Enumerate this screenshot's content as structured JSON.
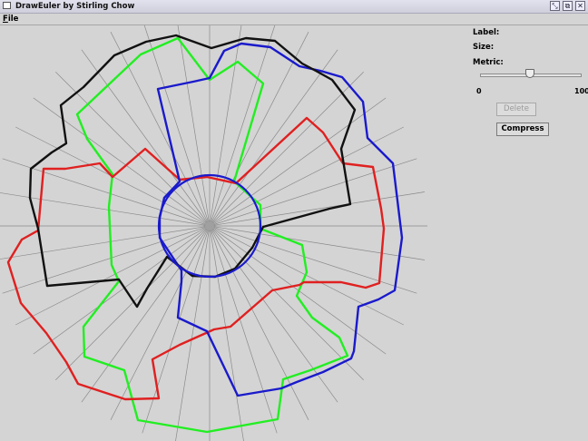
{
  "window": {
    "title": "DrawEuler by Stirling Chow",
    "controls": [
      "minimize-icon",
      "maximize-icon",
      "close-icon"
    ]
  },
  "menubar": {
    "file_label": "File"
  },
  "panel": {
    "label_label": "Label:",
    "size_label": "Size:",
    "metric_label": "Metric:",
    "slider": {
      "min_label": "0",
      "max_label": "100",
      "value": 50
    },
    "delete_label": "Delete",
    "compress_label": "Compress"
  },
  "diagram": {
    "spoke_count": 40,
    "colors": {
      "black": "#111111",
      "blue": "#1a1acc",
      "red": "#e02020",
      "green": "#22ee22",
      "spoke": "#8a8a8a"
    }
  }
}
